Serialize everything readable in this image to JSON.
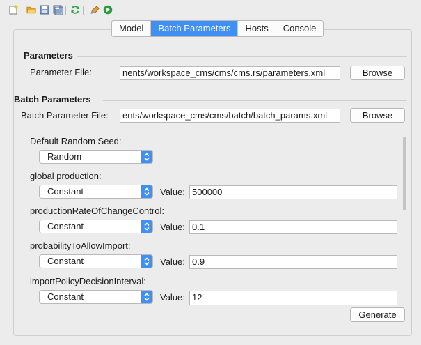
{
  "tabs": [
    {
      "label": "Model",
      "active": false
    },
    {
      "label": "Batch Parameters",
      "active": true
    },
    {
      "label": "Hosts",
      "active": false
    },
    {
      "label": "Console",
      "active": false
    }
  ],
  "toolbar_icons": [
    "new-icon",
    "open-folder-icon",
    "save-icon",
    "save-all-icon",
    "refresh-icon",
    "edit-icon",
    "run-icon"
  ],
  "parameters": {
    "title": "Parameters",
    "file_label": "Parameter File:",
    "file_value": "nents/workspace_cms/cms/cms.rs/parameters.xml",
    "browse_label": "Browse"
  },
  "batch": {
    "title": "Batch Parameters",
    "file_label": "Batch Parameter File:",
    "file_value": "ents/workspace_cms/cms/batch/batch_params.xml",
    "browse_label": "Browse"
  },
  "seed": {
    "label": "Default Random Seed:",
    "selected": "Random"
  },
  "params": [
    {
      "label": "global production:",
      "selected": "Constant",
      "value_label": "Value:",
      "value": "500000"
    },
    {
      "label": "productionRateOfChangeControl:",
      "selected": "Constant",
      "value_label": "Value:",
      "value": "0.1"
    },
    {
      "label": "probabilityToAllowImport:",
      "selected": "Constant",
      "value_label": "Value:",
      "value": "0.9"
    },
    {
      "label": "importPolicyDecisionInterval:",
      "selected": "Constant",
      "value_label": "Value:",
      "value": "12"
    }
  ],
  "generate_label": "Generate",
  "colors": {
    "accent": "#3f8ff4",
    "background": "#ececec"
  }
}
